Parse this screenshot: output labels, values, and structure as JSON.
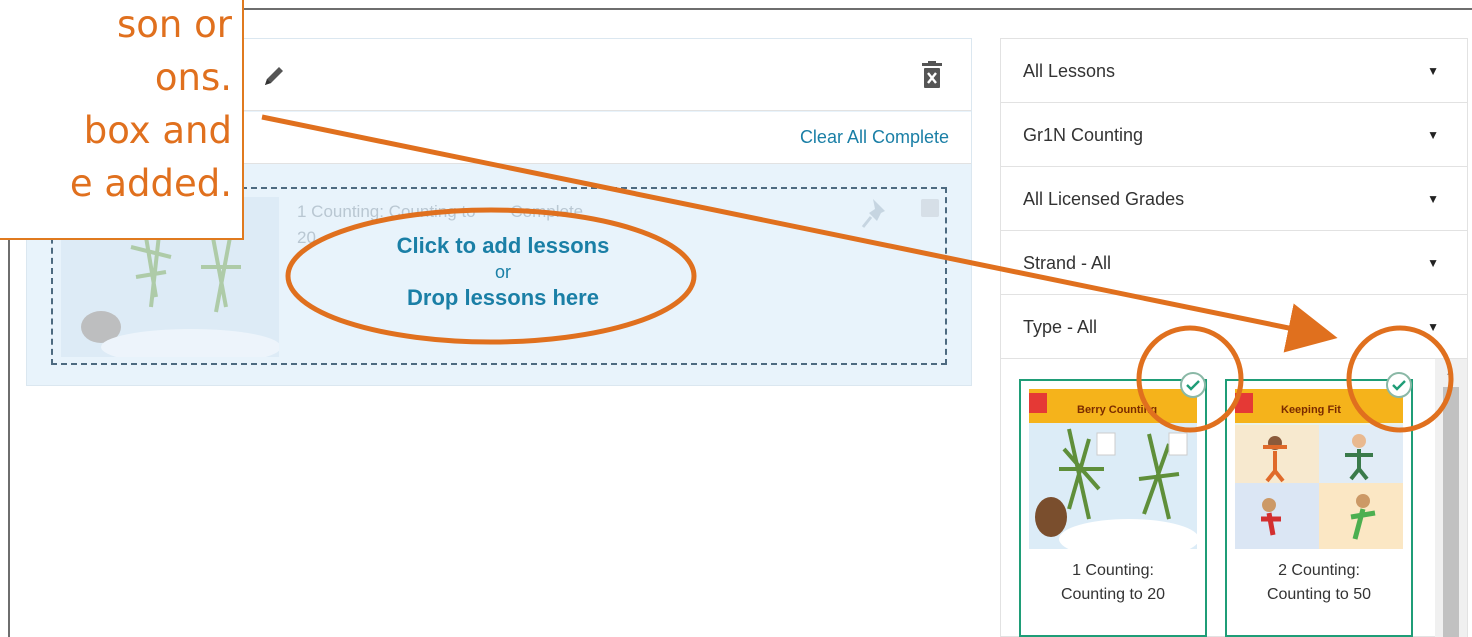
{
  "callout": {
    "lines": [
      "son or",
      "ons.",
      " box and",
      "e added."
    ]
  },
  "lesson_panel": {
    "clear_all_label": "Clear All Complete",
    "ghost_lesson": {
      "title_line1": "1 Counting: Counting to",
      "title_line2": "20",
      "status": "Complete"
    },
    "drop_zone": {
      "line1": "Click to add lessons",
      "line2": "or",
      "line3": "Drop lessons here"
    }
  },
  "filters": [
    {
      "label": "All Lessons"
    },
    {
      "label": "Gr1N Counting"
    },
    {
      "label": "All Licensed Grades"
    },
    {
      "label": "Strand - All"
    },
    {
      "label": "Type - All"
    }
  ],
  "lesson_cards": [
    {
      "caption_line1": "1 Counting:",
      "caption_line2": "Counting to 20",
      "thumb_title": "Berry Counting",
      "selected": true
    },
    {
      "caption_line1": "2 Counting:",
      "caption_line2": "Counting to 50",
      "thumb_title": "Keeping Fit",
      "selected": true
    }
  ],
  "colors": {
    "accent_orange": "#e0701e",
    "link_blue": "#1a7fa6",
    "card_green": "#1f9d77"
  },
  "icons": {
    "edit": "pencil-icon",
    "delete": "trash-icon",
    "pin": "pin-icon",
    "selected": "check-circle-icon",
    "dropdown": "caret-down-icon"
  }
}
